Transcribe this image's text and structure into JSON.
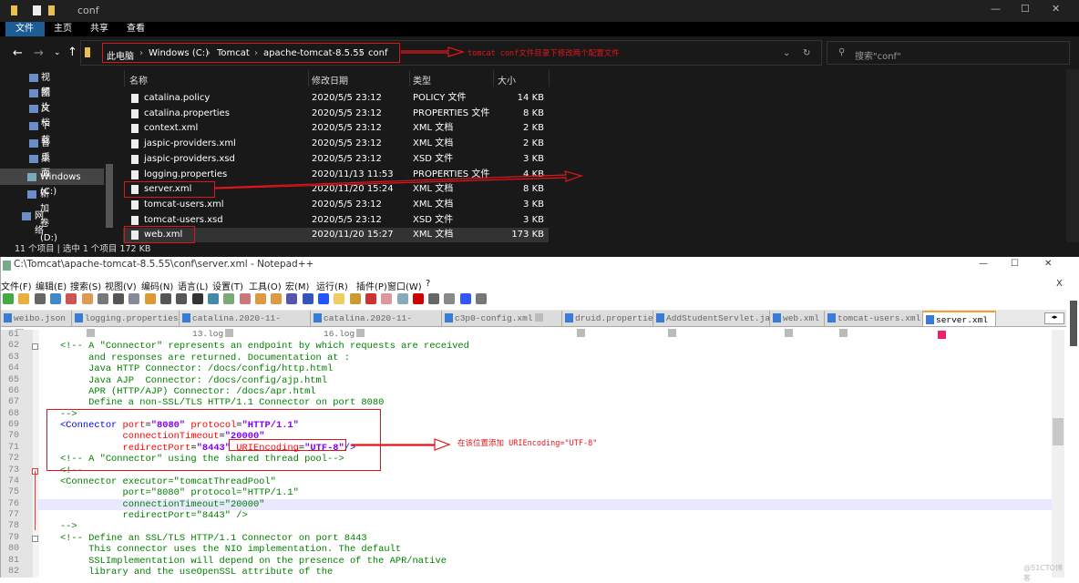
{
  "explorer": {
    "title": "conf",
    "ribbon_tabs": [
      "文件",
      "主页",
      "共享",
      "查看"
    ],
    "breadcrumb": [
      "此电脑",
      "Windows (C:)",
      "Tomcat",
      "apache-tomcat-8.5.55",
      "conf"
    ],
    "search_placeholder": "搜索\"conf\"",
    "annotation": "tomcat conf文件目录下修改两个配置文件",
    "nav": [
      "视频",
      "图片",
      "文档",
      "下载",
      "音乐",
      "桌面",
      "Windows (C:)",
      "新加卷 (D:)",
      "网络"
    ],
    "columns": [
      "名称",
      "修改日期",
      "类型",
      "大小"
    ],
    "files": [
      {
        "name": "catalina.policy",
        "date": "2020/5/5 23:12",
        "type": "POLICY 文件",
        "size": "14 KB"
      },
      {
        "name": "catalina.properties",
        "date": "2020/5/5 23:12",
        "type": "PROPERTIES 文件",
        "size": "8 KB"
      },
      {
        "name": "context.xml",
        "date": "2020/5/5 23:12",
        "type": "XML 文档",
        "size": "2 KB"
      },
      {
        "name": "jaspic-providers.xml",
        "date": "2020/5/5 23:12",
        "type": "XML 文档",
        "size": "2 KB"
      },
      {
        "name": "jaspic-providers.xsd",
        "date": "2020/5/5 23:12",
        "type": "XSD 文件",
        "size": "3 KB"
      },
      {
        "name": "logging.properties",
        "date": "2020/11/13 11:53",
        "type": "PROPERTIES 文件",
        "size": "4 KB"
      },
      {
        "name": "server.xml",
        "date": "2020/11/20 15:24",
        "type": "XML 文档",
        "size": "8 KB"
      },
      {
        "name": "tomcat-users.xml",
        "date": "2020/5/5 23:12",
        "type": "XML 文档",
        "size": "3 KB"
      },
      {
        "name": "tomcat-users.xsd",
        "date": "2020/5/5 23:12",
        "type": "XSD 文件",
        "size": "3 KB"
      },
      {
        "name": "web.xml",
        "date": "2020/11/20 15:27",
        "type": "XML 文档",
        "size": "173 KB"
      }
    ],
    "status": "11 个项目  |  选中 1 个项目  172 KB"
  },
  "notepad": {
    "title": "C:\\Tomcat\\apache-tomcat-8.5.55\\conf\\server.xml - Notepad++",
    "menu": [
      "文件(F)",
      "编辑(E)",
      "搜索(S)",
      "视图(V)",
      "编码(N)",
      "语言(L)",
      "设置(T)",
      "工具(O)",
      "宏(M)",
      "运行(R)",
      "插件(P)",
      "窗口(W)",
      "?"
    ],
    "tabs": [
      "weibo.json",
      "logging.properties",
      "catalina.2020-11-13.log",
      "catalina.2020-11-16.log",
      "c3p0-config.xml",
      "druid.properties",
      "AddStudentServlet.java",
      "web.xml",
      "tomcat-users.xml",
      "server.xml"
    ],
    "active_tab": "server.xml",
    "annotation": "在该位置添加 URIEncoding=\"UTF-8\"",
    "first_line": 61,
    "highlight_line": 76,
    "lines": [
      [],
      [
        [
          "c",
          "    <!-- A \"Connector\" represents an endpoint by which requests are received"
        ]
      ],
      [
        [
          "c",
          "         and responses are returned. Documentation at :"
        ]
      ],
      [
        [
          "c",
          "         Java HTTP Connector: /docs/config/http.html"
        ]
      ],
      [
        [
          "c",
          "         Java AJP  Connector: /docs/config/ajp.html"
        ]
      ],
      [
        [
          "c",
          "         APR (HTTP/AJP) Connector: /docs/apr.html"
        ]
      ],
      [
        [
          "c",
          "         Define a non-SSL/TLS HTTP/1.1 Connector on port 8080"
        ]
      ],
      [
        [
          "c",
          "    -->"
        ]
      ],
      [
        [
          "t",
          "    <Connector "
        ],
        [
          "a",
          "port"
        ],
        [
          "p",
          "="
        ],
        [
          "v",
          "\"8080\""
        ],
        [
          "p",
          " "
        ],
        [
          "a",
          "protocol"
        ],
        [
          "p",
          "="
        ],
        [
          "v",
          "\"HTTP/1.1\""
        ]
      ],
      [
        [
          "a",
          "               connectionTimeout"
        ],
        [
          "p",
          "="
        ],
        [
          "v",
          "\"20000\""
        ]
      ],
      [
        [
          "a",
          "               redirectPort"
        ],
        [
          "p",
          "="
        ],
        [
          "v",
          "\"8443\""
        ],
        [
          "p",
          " "
        ],
        [
          "a",
          "URIEncoding"
        ],
        [
          "p",
          "="
        ],
        [
          "v",
          "\"UTF-8\""
        ],
        [
          "t",
          "/>"
        ]
      ],
      [
        [
          "c",
          "    <!-- A \"Connector\" using the shared thread pool-->"
        ]
      ],
      [
        [
          "c",
          "    <!--"
        ]
      ],
      [
        [
          "c",
          "    <Connector executor=\"tomcatThreadPool\""
        ]
      ],
      [
        [
          "c",
          "               port=\"8080\" protocol=\"HTTP/1.1\""
        ]
      ],
      [
        [
          "c",
          "               connectionTimeout=\"20000\""
        ]
      ],
      [
        [
          "c",
          "               redirectPort=\"8443\" />"
        ]
      ],
      [
        [
          "c",
          "    -->"
        ]
      ],
      [
        [
          "c",
          "    <!-- Define an SSL/TLS HTTP/1.1 Connector on port 8443"
        ]
      ],
      [
        [
          "c",
          "         This connector uses the NIO implementation. The default"
        ]
      ],
      [
        [
          "c",
          "         SSLImplementation will depend on the presence of the APR/native"
        ]
      ],
      [
        [
          "c",
          "         library and the useOpenSSL attribute of the"
        ]
      ]
    ]
  },
  "watermark": "@51CTO博客"
}
